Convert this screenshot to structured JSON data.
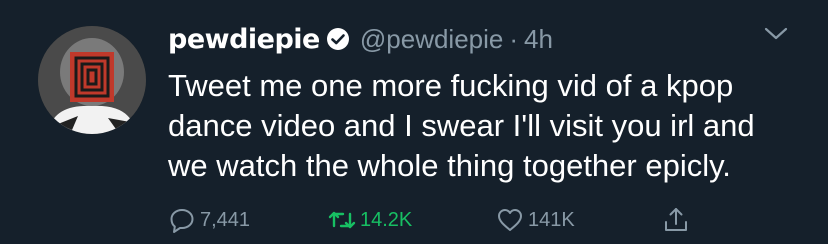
{
  "tweet": {
    "display_name": "pewdiepie",
    "handle": "@pewdiepie",
    "separator": "·",
    "time": "4h",
    "text": "Tweet me one more fucking vid of a kpop\ndance video and I swear I'll visit you irl and\nwe watch the whole thing together epicly."
  },
  "actions": {
    "reply_count": "7,441",
    "retweet_count": "14.2K",
    "like_count": "141K"
  },
  "icons": {
    "verified": "verified-badge-icon",
    "more": "chevron-down-icon",
    "reply": "reply-icon",
    "retweet": "retweet-icon",
    "like": "heart-icon",
    "share": "share-icon"
  },
  "colors": {
    "background": "#15202b",
    "secondary_text": "#8899a6",
    "retweet_active": "#17bf63",
    "avatar_square": "#c0392b"
  }
}
